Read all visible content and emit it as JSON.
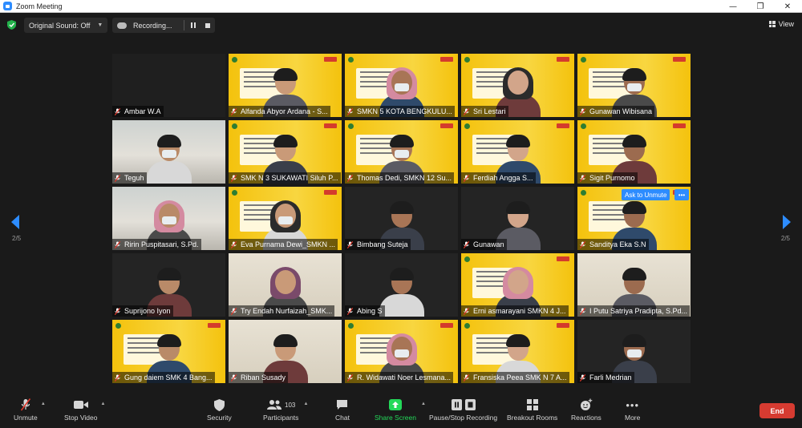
{
  "window": {
    "title": "Zoom Meeting",
    "controls": {
      "minimize": "—",
      "maximize": "❐",
      "close": "✕"
    }
  },
  "topbar": {
    "original_sound": "Original Sound: Off",
    "recording": "Recording...",
    "view": "View"
  },
  "pager": {
    "left_label": "2/5",
    "right_label": "2/5"
  },
  "participants": [
    {
      "name": "Ambar W.A",
      "kind": "ambar"
    },
    {
      "name": "Alfanda Abyor Ardana - S...",
      "kind": "slide"
    },
    {
      "name": "SMKN 5 KOTA BENGKULU...",
      "kind": "slide"
    },
    {
      "name": "Sri Lestari",
      "kind": "slide"
    },
    {
      "name": "Gunawan Wibisana",
      "kind": "slide"
    },
    {
      "name": "Teguh",
      "kind": "room"
    },
    {
      "name": "SMK N 3 SUKAWATI Siluh P...",
      "kind": "slide"
    },
    {
      "name": "Thomas Dedi, SMKN 12 Su...",
      "kind": "slide"
    },
    {
      "name": "Ferdiah Angga S...",
      "kind": "slide"
    },
    {
      "name": "Sigit Purnomo",
      "kind": "slide"
    },
    {
      "name": "Ririn Puspitasari, S.Pd.",
      "kind": "room"
    },
    {
      "name": "Eva Purnama Dewi_SMKN ...",
      "kind": "slide"
    },
    {
      "name": "Bimbang Suteja",
      "kind": "dark"
    },
    {
      "name": "Gunawan",
      "kind": "dark"
    },
    {
      "name": "Sanditya Eka S.N",
      "kind": "slide"
    },
    {
      "name": "Suprijono Iyon",
      "kind": "dark"
    },
    {
      "name": "Try Endah Nurfaizah_SMK...",
      "kind": "wall"
    },
    {
      "name": "Abing S",
      "kind": "dark"
    },
    {
      "name": "Erni asmarayani SMKN 4 J...",
      "kind": "slide"
    },
    {
      "name": "I Putu Satriya Pradipta, S.Pd...",
      "kind": "wall"
    },
    {
      "name": "Gung daiem SMK 4 Bang...",
      "kind": "slide"
    },
    {
      "name": "Riban Susady",
      "kind": "wall"
    },
    {
      "name": "R. Widawati Noer Lesmana...",
      "kind": "slide"
    },
    {
      "name": "Fransiska Peea SMK N 7 A...",
      "kind": "slide"
    },
    {
      "name": "Farli Medrian",
      "kind": "dark"
    }
  ],
  "ask_to_unmute": "Ask to Unmute",
  "more_dots": "•••",
  "toolbar": {
    "unmute": "Unmute",
    "stop_video": "Stop Video",
    "security": "Security",
    "participants": "Participants",
    "participants_count": "103",
    "chat": "Chat",
    "share_screen": "Share Screen",
    "pause_stop_recording": "Pause/Stop Recording",
    "breakout_rooms": "Breakout Rooms",
    "reactions": "Reactions",
    "more": "More",
    "end": "End"
  },
  "colors": {
    "accent": "#2d8cff",
    "share_green": "#23d959",
    "end_red": "#d63b31",
    "muted_red": "#e0372b",
    "slide_yellow": "#f4c20d"
  },
  "icons": {
    "shield": "green-shield-icon",
    "mic_muted": "mic-muted-icon",
    "video": "video-camera-icon"
  }
}
